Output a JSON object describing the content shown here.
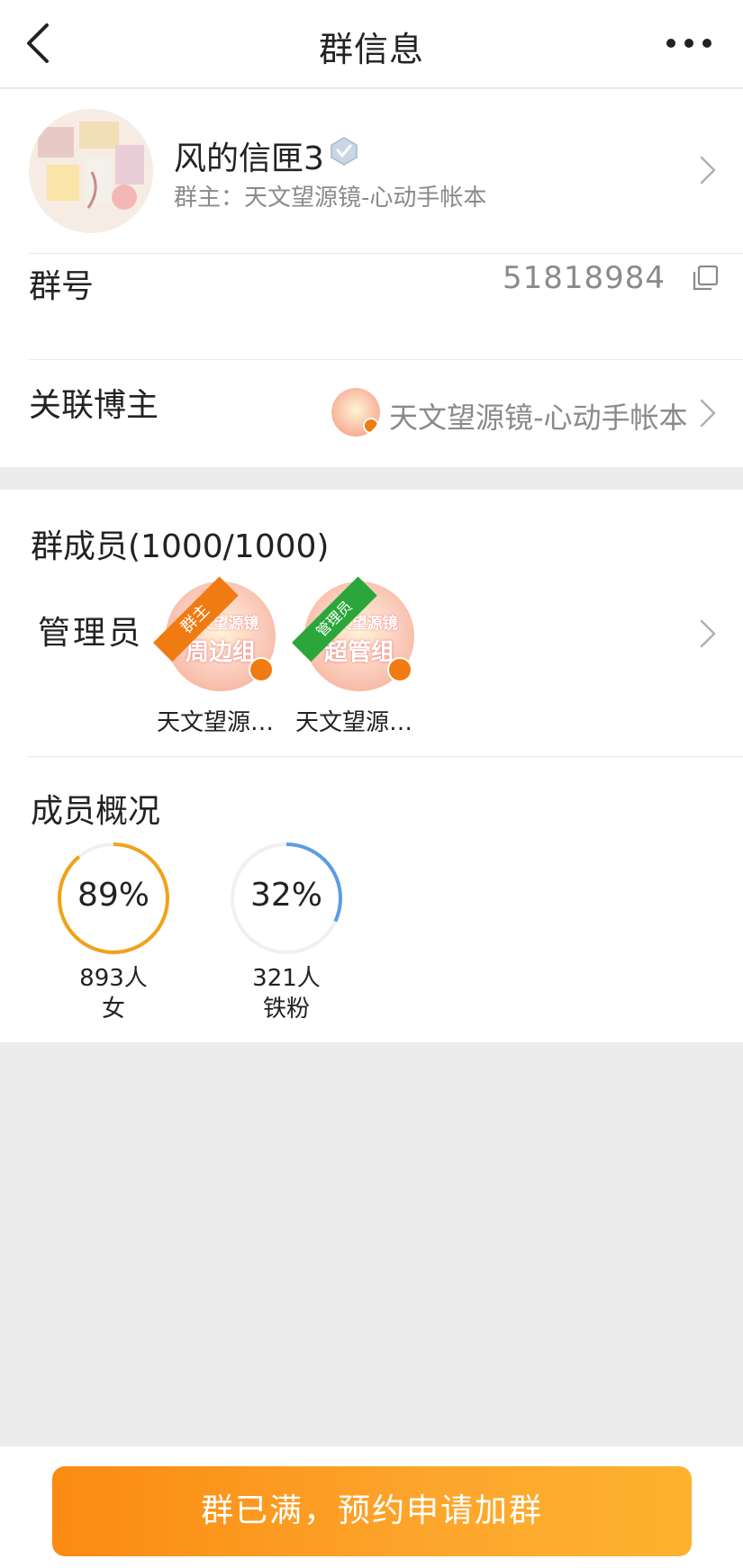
{
  "header": {
    "title": "群信息"
  },
  "group": {
    "name": "风的信匣3",
    "owner_line": "群主：天文望源镜-心动手帐本",
    "id_label": "群号",
    "id_value": "51818984",
    "blogger_label": "关联博主",
    "blogger_name": "天文望源镜-心动手帐本"
  },
  "members": {
    "title": "群成员(1000/1000)",
    "admin_label": "管理员",
    "admins": [
      {
        "role_tag": "群主",
        "avatar_line1": "天文望源镜",
        "avatar_line2": "周边组",
        "name": "天文望源…",
        "tag_color": "#f07b12"
      },
      {
        "role_tag": "管理员",
        "avatar_line1": "天文望源镜",
        "avatar_line2": "超管组",
        "name": "天文望源…",
        "tag_color": "#2aa63a"
      }
    ]
  },
  "overview": {
    "title": "成员概况",
    "stats": [
      {
        "percent_text": "89%",
        "percent": 0.89,
        "count": "893人",
        "label": "女",
        "color": "#f0a21a"
      },
      {
        "percent_text": "32%",
        "percent": 0.32,
        "count": "321人",
        "label": "铁粉",
        "color": "#5b9ce6"
      }
    ]
  },
  "footer": {
    "join_label": "群已满，预约申请加群"
  },
  "colors": {
    "accent": "#fb8a12",
    "muted_text": "#8a8a8a"
  }
}
